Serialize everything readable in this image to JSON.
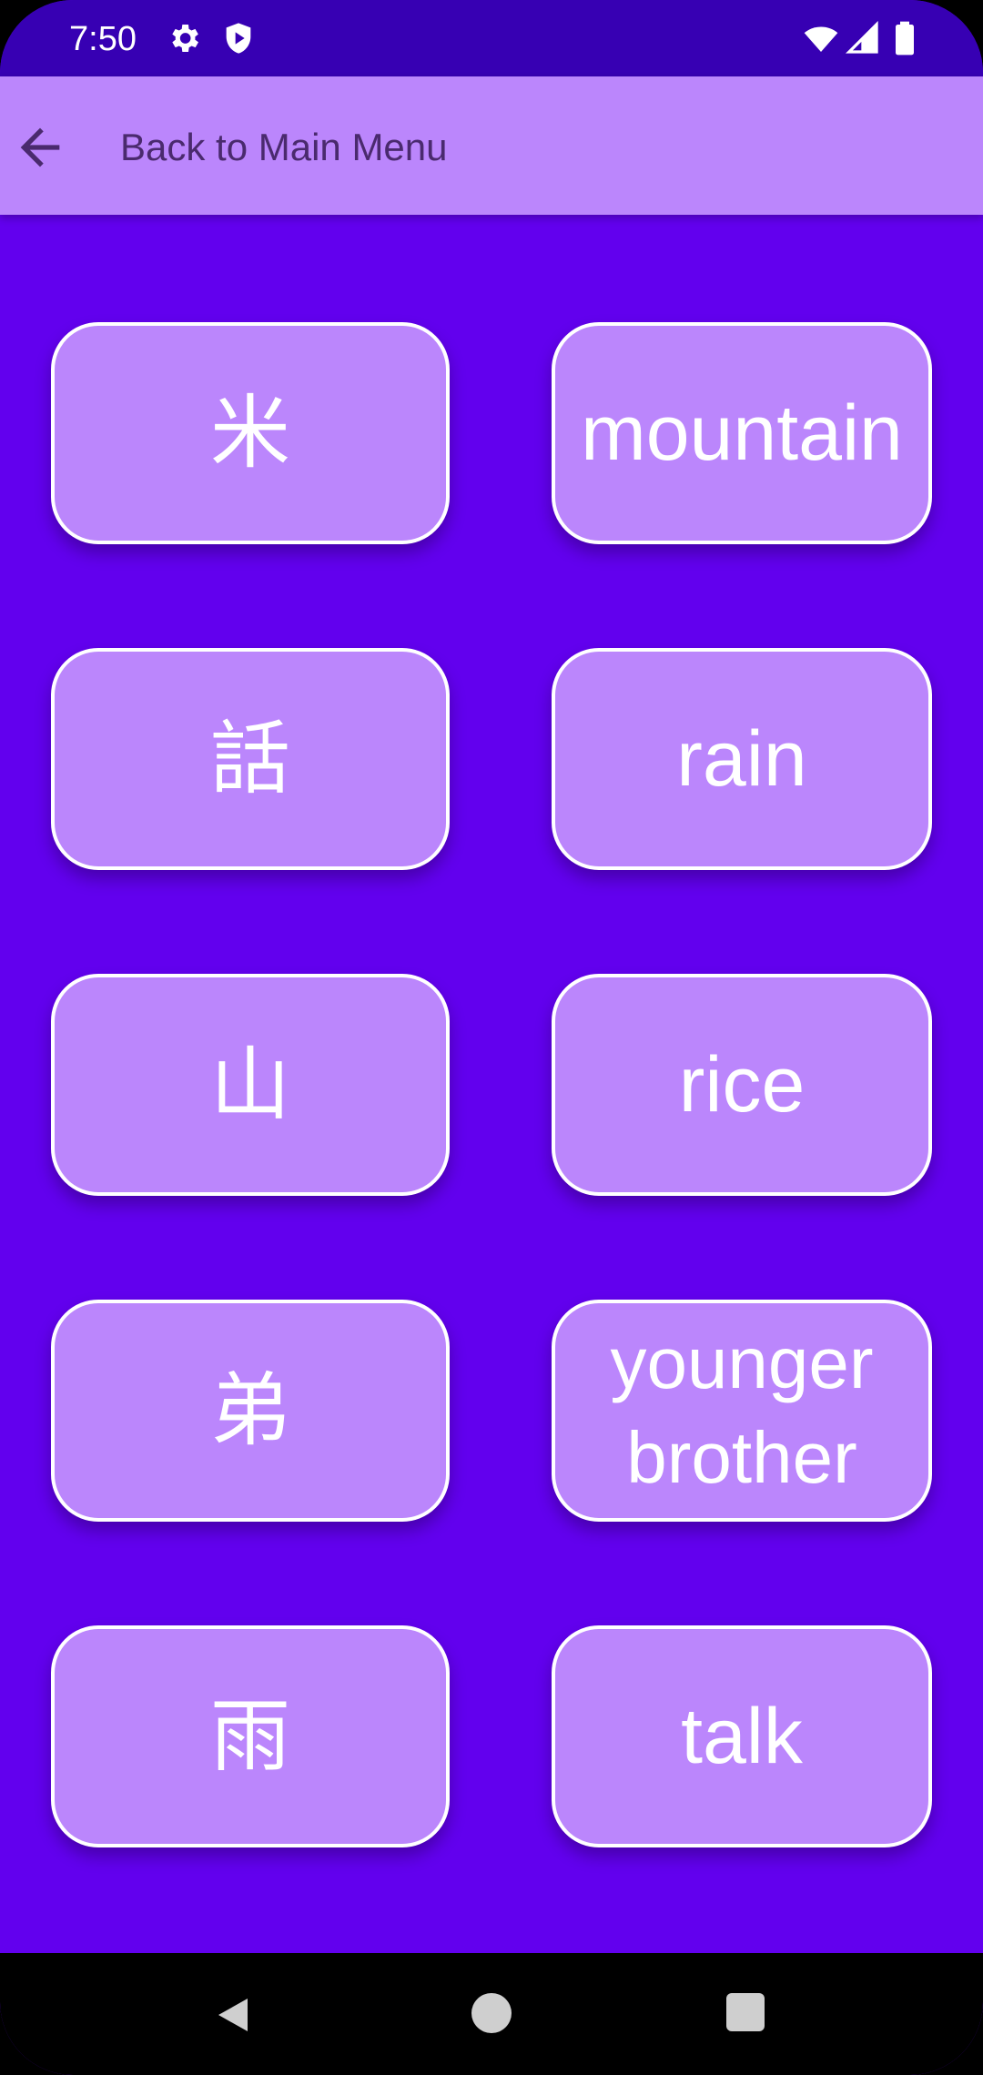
{
  "status_bar": {
    "time": "7:50",
    "icons_left": [
      "settings-gear-icon",
      "shield-play-icon"
    ],
    "icons_right": [
      "wifi-icon",
      "cell-signal-icon",
      "battery-icon"
    ]
  },
  "app_bar": {
    "back_icon": "arrow-left-icon",
    "title": "Back to Main Menu"
  },
  "cards": {
    "left": [
      "米",
      "話",
      "山",
      "弟",
      "雨"
    ],
    "right": [
      "mountain",
      "rain",
      "rice",
      "younger\nbrother",
      "talk"
    ]
  },
  "nav_bar": {
    "icons": [
      "nav-back-icon",
      "nav-home-icon",
      "nav-recents-icon"
    ]
  },
  "colors": {
    "background": "#6200EE",
    "status_bar": "#3700B3",
    "app_bar": "#BB86FC",
    "card": "#BB86FC",
    "card_border": "#FFFFFF"
  }
}
